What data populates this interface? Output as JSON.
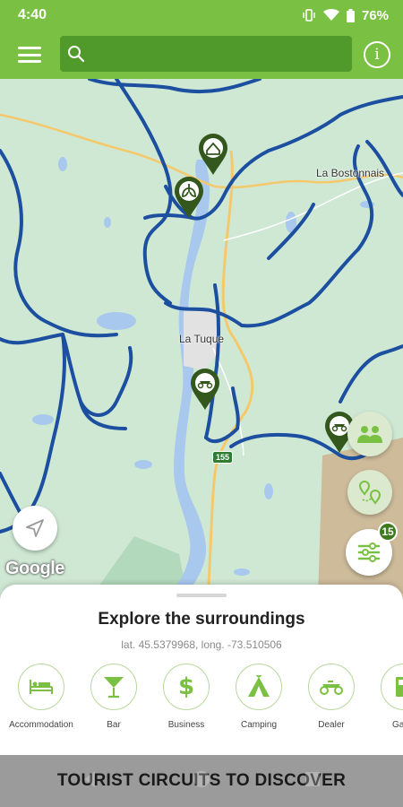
{
  "status_bar": {
    "time": "4:40",
    "battery": "76%"
  },
  "search": {
    "placeholder": ""
  },
  "map": {
    "place_labels": [
      "La Bostonnais",
      "La Tuque"
    ],
    "route_shield": "155",
    "attribution": "Google",
    "filter_badge_count": "15",
    "colors": {
      "land": "#cfe8d4",
      "water": "#a8c8ee",
      "trail": "#1d4fa0",
      "road": "#f5c96b",
      "pin": "#33571c"
    }
  },
  "sheet": {
    "title": "Explore the surroundings",
    "coords": "lat. 45.5379968, long. -73.510506",
    "categories": [
      {
        "label": "Accommodation",
        "icon": "bed-icon"
      },
      {
        "label": "Bar",
        "icon": "cocktail-icon"
      },
      {
        "label": "Business",
        "icon": "dollar-icon"
      },
      {
        "label": "Camping",
        "icon": "tent-icon"
      },
      {
        "label": "Dealer",
        "icon": "atv-icon"
      },
      {
        "label": "Gas s",
        "icon": "gas-pump-icon"
      }
    ]
  },
  "banner": {
    "text": "TOURIST CIRCUITS TO DISCOVER"
  },
  "accent_color": "#7ac143"
}
